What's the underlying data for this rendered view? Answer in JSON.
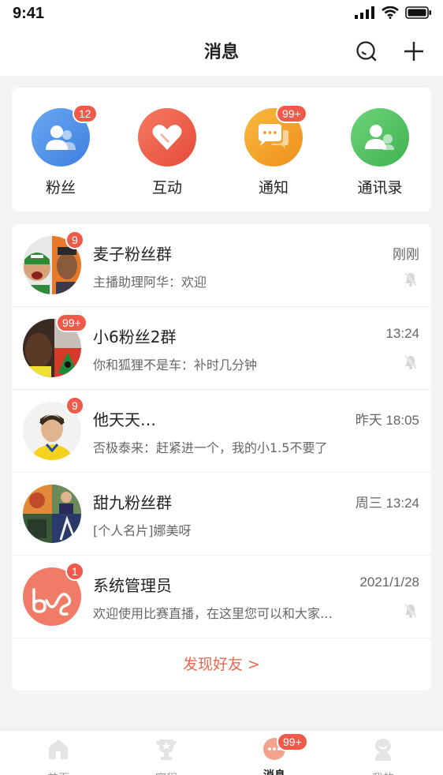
{
  "status_bar": {
    "time": "9:41"
  },
  "header": {
    "title": "消息"
  },
  "quick_actions": [
    {
      "label": "粉丝",
      "badge": "12",
      "icon": "fans-icon",
      "color": "#4a8ee8"
    },
    {
      "label": "互动",
      "badge": "",
      "icon": "heart-icon",
      "color": "#ee5b45"
    },
    {
      "label": "通知",
      "badge": "99+",
      "icon": "chat-bubble-icon",
      "color": "#f3a12b"
    },
    {
      "label": "通讯录",
      "badge": "",
      "icon": "contacts-icon",
      "color": "#4fc15a"
    }
  ],
  "conversations": [
    {
      "name": "麦子粉丝群",
      "time": "刚刚",
      "preview": "主播助理阿华：欢迎",
      "badge": "9",
      "muted": true
    },
    {
      "name": "小6粉丝2群",
      "time": "13:24",
      "preview": "你和狐狸不是车：补时几分钟",
      "badge": "99+",
      "muted": true
    },
    {
      "name": "他天天…",
      "time": "昨天 18:05",
      "preview": "否极泰来：赶紧进一个，我的小1.5不要了",
      "badge": "9",
      "muted": false
    },
    {
      "name": "甜九粉丝群",
      "time": "周三 13:24",
      "preview": "[个人名片]娜美呀",
      "badge": "",
      "muted": false
    },
    {
      "name": "系统管理员",
      "time": "2021/1/28",
      "preview": "欢迎使用比赛直播，在这里您可以和大家…",
      "badge": "1",
      "muted": true
    }
  ],
  "discover": {
    "label": "发现好友 >"
  },
  "tabbar": {
    "tabs": [
      {
        "label": "首页",
        "active": false,
        "badge": ""
      },
      {
        "label": "赛程",
        "active": false,
        "badge": ""
      },
      {
        "label": "消息",
        "active": true,
        "badge": "99+"
      },
      {
        "label": "我的",
        "active": false,
        "badge": ""
      }
    ]
  },
  "colors": {
    "accent": "#e86a4f",
    "badge": "#ef5a4a"
  }
}
